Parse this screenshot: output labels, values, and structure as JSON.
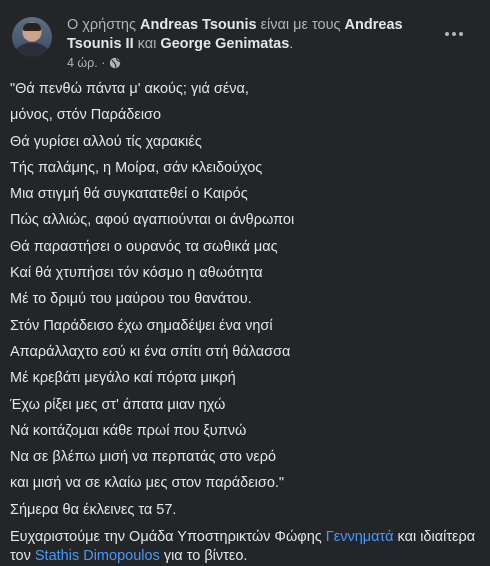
{
  "post": {
    "header": {
      "prefix": "Ο χρήστης ",
      "author": "Andreas Tsounis",
      "middle": " είναι με τους ",
      "tagged_1": "Andreas Tsounis II",
      "conjunction": " και ",
      "tagged_2": "George Genimatas",
      "end": "."
    },
    "timestamp": "4 ώρ. ·",
    "privacy_icon": "globe-icon",
    "more_icon": "more-horizontal-icon",
    "poem_lines": [
      "\"Θά πενθώ πάντα μ' ακούς; γιά σένα,",
      "μόνος, στόν Παράδεισο",
      "Θά γυρίσει αλλού τίς χαρακιές",
      "Τής παλάμης, η Μοίρα, σάν κλειδούχος",
      "Μια στιγμή θά συγκατατεθεί ο Καιρός",
      "Πώς αλλιώς, αφού αγαπιούνται οι άνθρωποι",
      "Θά παραστήσει ο ουρανός τα σωθικά μας",
      "Καί θά χτυπήσει τόν κόσμο η αθωότητα",
      "Μέ το δριμύ του μαύρου του θανάτου.",
      "Στόν Παράδεισο έχω σημαδέψει ένα νησί",
      "Απαράλλαχτο εσύ κι ένα σπίτι στή θάλασσα",
      "Μέ κρεβάτι μεγάλο καί πόρτα μικρή",
      "Έχω ρίξει μες στ' άπατα μιαν ηχώ",
      "Νά κοιτάζομαι κάθε πρωί που ξυπνώ",
      "Να σε βλέπω μισή να περπατάς στο νερό",
      "και μισή να σε κλαίω μες στον παράδεισο.\""
    ],
    "birthday_line": "Σήμερα θα έκλεινες τα 57.",
    "thanks": {
      "before": "Ευχαριστούμε την Ομάδα Υποστηρικτών Φώφης ",
      "link_1": "Γεννηματά",
      "middle": " και ιδιαίτερα τον ",
      "link_2": "Stathis Dimopoulos",
      "after": " για το βίντεο."
    }
  }
}
